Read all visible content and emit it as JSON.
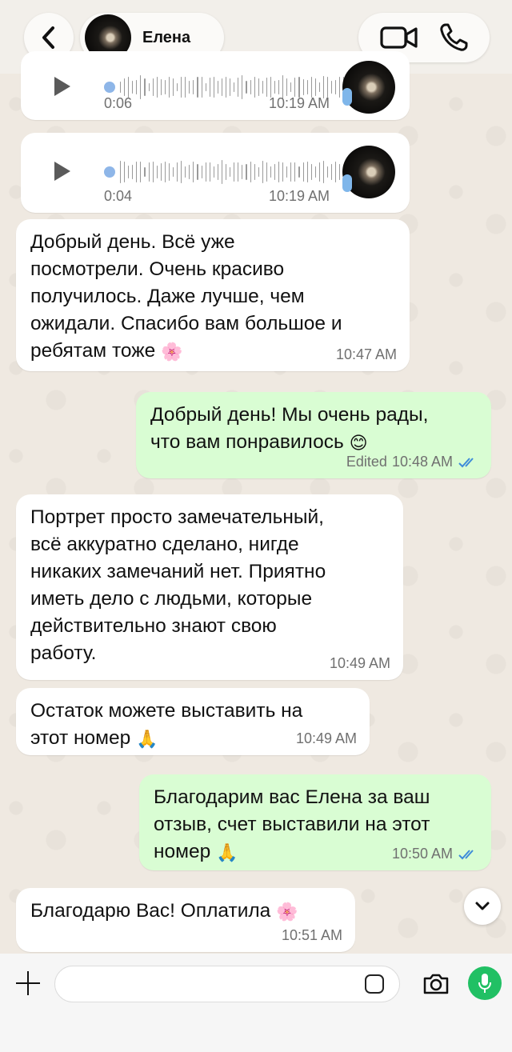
{
  "header": {
    "contact_name": "Елена",
    "back_icon": "chevron-left-icon",
    "video_icon": "video-camera-icon",
    "call_icon": "phone-icon"
  },
  "messages": [
    {
      "type": "voice",
      "direction": "in",
      "duration": "0:06",
      "time": "10:19 AM"
    },
    {
      "type": "voice",
      "direction": "in",
      "duration": "0:04",
      "time": "10:19 AM"
    },
    {
      "type": "text",
      "direction": "in",
      "text": "Добрый день. Всё уже\nпосмотрели. Очень красиво\nполучилось. Даже лучше, чем\nожидали. Спасибо вам большое и\nребятам тоже",
      "emoji": "🌸",
      "time": "10:47 AM"
    },
    {
      "type": "text",
      "direction": "out",
      "text": "Добрый день! Мы очень рады,\nчто вам понравилось",
      "emoji": "😊",
      "edited_label": "Edited",
      "time": "10:48 AM",
      "status": "read"
    },
    {
      "type": "text",
      "direction": "in",
      "text": "Портрет просто замечательный,\nвсё аккуратно сделано, нигде\nникаких замечаний нет. Приятно\nиметь дело с людьми, которые\nдействительно знают свою\nработу.",
      "time": "10:49 AM"
    },
    {
      "type": "text",
      "direction": "in",
      "text": "Остаток можете выставить на\nэтот номер",
      "emoji": "🙏",
      "time": "10:49 AM"
    },
    {
      "type": "text",
      "direction": "out",
      "text": "Благодарим вас Елена за ваш\nотзыв, счет выставили на этот\nномер",
      "emoji": "🙏",
      "time": "10:50 AM",
      "status": "read"
    },
    {
      "type": "text",
      "direction": "in",
      "text": "Благодарю Вас! Оплатила",
      "emoji": "🌸",
      "time": "10:51 AM"
    }
  ],
  "composer": {
    "input_value": "",
    "plus_icon": "plus-icon",
    "sticker_icon": "sticker-icon",
    "camera_icon": "camera-icon",
    "mic_icon": "microphone-icon",
    "accent_color": "#21c064"
  },
  "colors": {
    "incoming_bubble": "#ffffff",
    "outgoing_bubble": "#d9fdd3",
    "read_ticks": "#3d8bd9"
  }
}
